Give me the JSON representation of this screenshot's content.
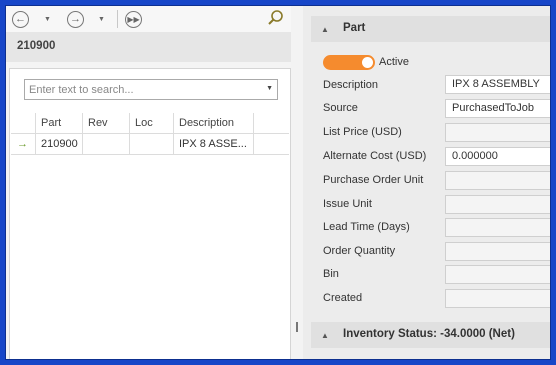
{
  "left_header": {
    "title": "210900"
  },
  "search": {
    "placeholder": "Enter text to search..."
  },
  "grid": {
    "columns": [
      "",
      "Part",
      "Rev",
      "Loc",
      "Description"
    ],
    "rows": [
      {
        "indicator": "→",
        "part": "210900",
        "rev": "",
        "loc": "",
        "description": "IPX 8 ASSE..."
      }
    ]
  },
  "part_section": {
    "title": "Part",
    "active_label": "Active",
    "active": true,
    "fields": [
      {
        "label": "Description",
        "value": "IPX 8 ASSEMBLY"
      },
      {
        "label": "Source",
        "value": "PurchasedToJob"
      },
      {
        "label": "List Price (USD)",
        "value": ""
      },
      {
        "label": "Alternate Cost (USD)",
        "value": "0.000000"
      },
      {
        "label": "Purchase Order Unit",
        "value": ""
      },
      {
        "label": "Issue Unit",
        "value": ""
      },
      {
        "label": "Lead Time (Days)",
        "value": ""
      },
      {
        "label": "Order Quantity",
        "value": ""
      },
      {
        "label": "Bin",
        "value": ""
      },
      {
        "label": "Created",
        "value": ""
      }
    ]
  },
  "inventory_section": {
    "title": "Inventory Status: -34.0000 (Net)"
  },
  "colors": {
    "accent": "#f58b2e",
    "border_blue": "#1746c8"
  }
}
